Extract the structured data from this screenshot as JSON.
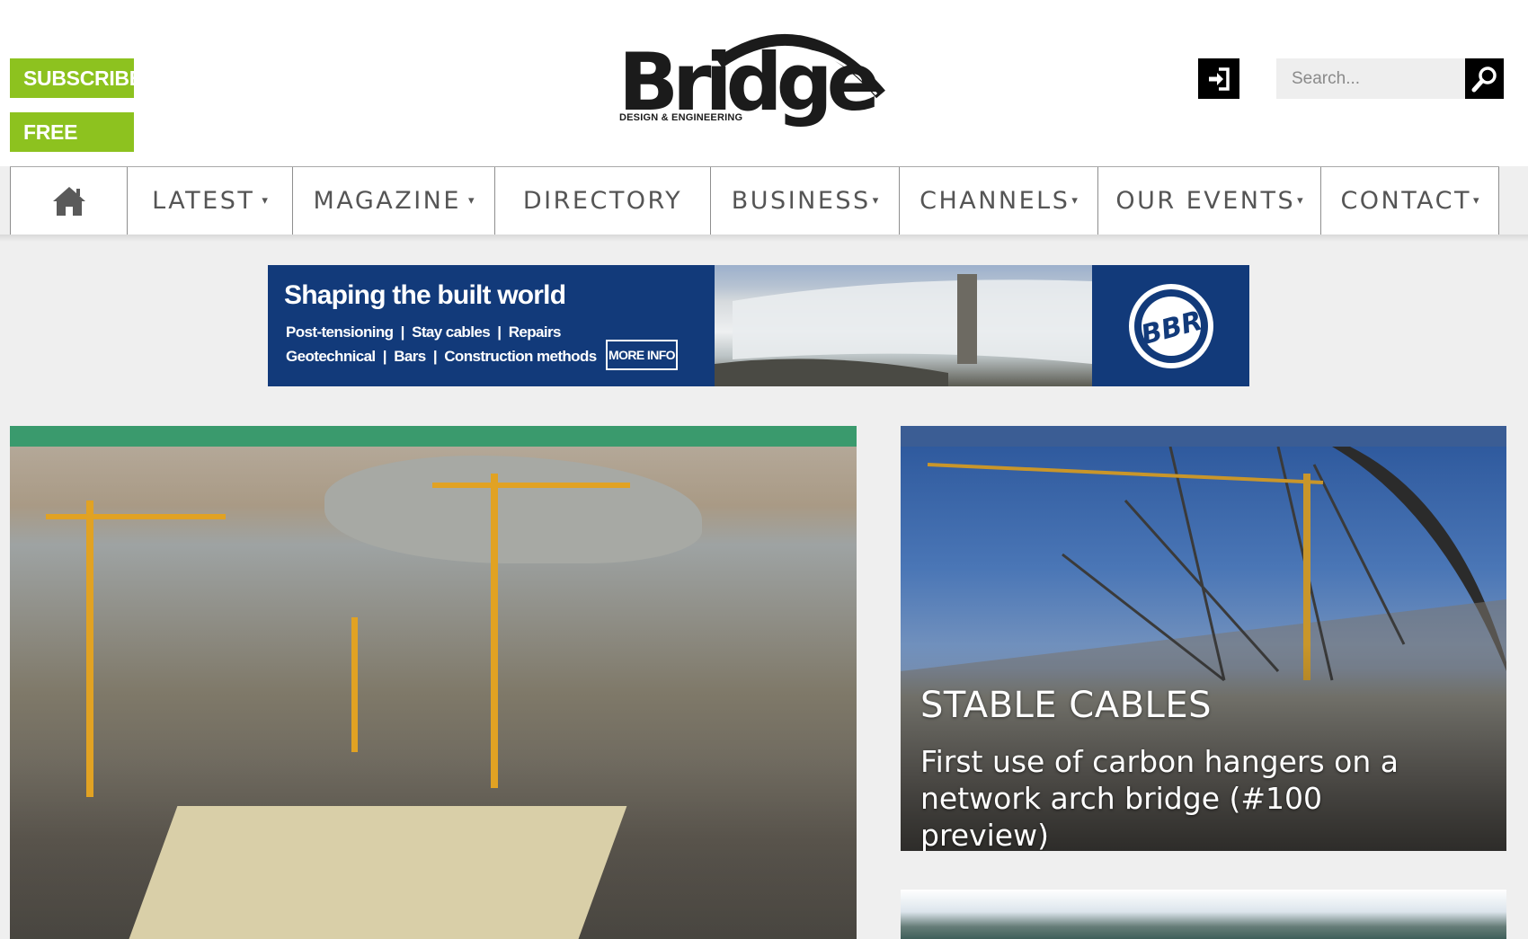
{
  "header": {
    "subscribe_label": "SUBSCRIBE",
    "free_trial_label": "FREE TRIAL",
    "logo_word": "Bridge",
    "logo_tagline": "DESIGN & ENGINEERING",
    "search_placeholder": "Search..."
  },
  "nav": {
    "items": [
      {
        "label": "LATEST",
        "has_caret": true
      },
      {
        "label": "MAGAZINE",
        "has_caret": true
      },
      {
        "label": "DIRECTORY",
        "has_caret": false
      },
      {
        "label": "BUSINESS",
        "has_caret": true
      },
      {
        "label": "CHANNELS",
        "has_caret": true
      },
      {
        "label": "OUR EVENTS",
        "has_caret": true
      },
      {
        "label": "CONTACT",
        "has_caret": true
      }
    ],
    "caret_glyph": "▾"
  },
  "ad": {
    "title": "Shaping the built world",
    "line1": "Post-tensioning  |  Stay cables  |  Repairs",
    "line2": "Geotechnical  |  Bars  |  Construction methods",
    "cta": "MORE INFO",
    "logo_text": "BBR"
  },
  "featured_right": {
    "kicker": "STABLE CABLES",
    "headline": "First use of carbon hangers on a network arch bridge (#100 preview)"
  },
  "colors": {
    "promo_green": "#8dc21f",
    "left_card_bar": "#3a9a6d",
    "right_card_bar": "#3b5d94",
    "ad_blue": "#123a7a"
  },
  "icons": [
    "home-icon",
    "login-icon",
    "search-icon",
    "caret-down-icon"
  ]
}
